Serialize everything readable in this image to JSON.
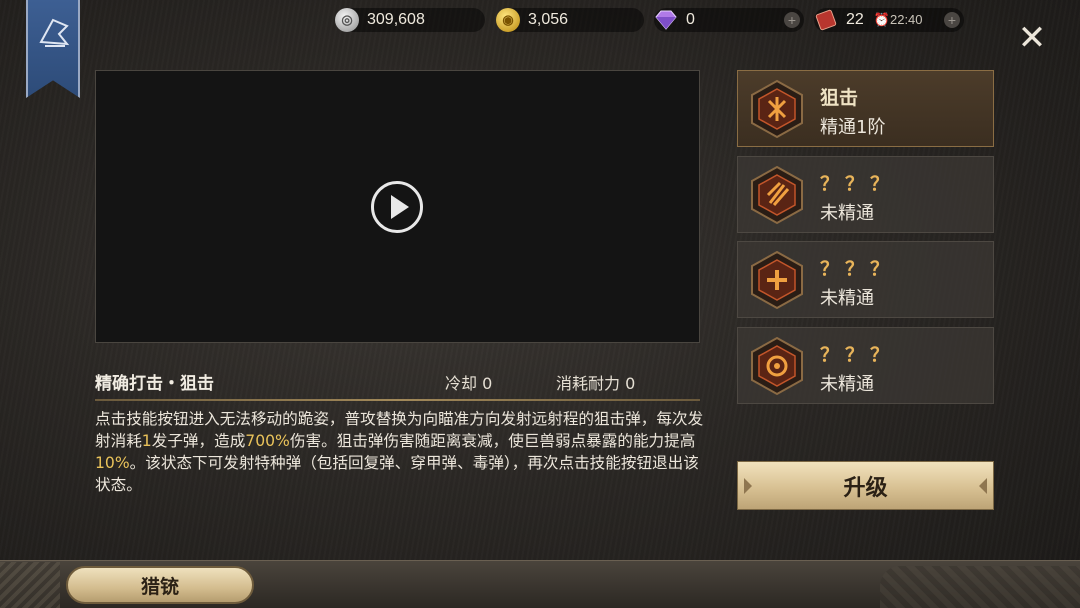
{
  "header": {
    "currencies": {
      "silver": {
        "value": "309,608",
        "icon": "silver-coin-icon"
      },
      "gold": {
        "value": "3,056",
        "icon": "gold-coin-icon"
      },
      "gem": {
        "value": "0",
        "icon": "diamond-icon"
      },
      "ticket": {
        "value": "22",
        "icon": "ticket-icon",
        "timer": "22:40"
      }
    },
    "close_label": "✕"
  },
  "skill": {
    "title": "精确打击・狙击",
    "cooldown": "冷却 0",
    "stamina_cost": "消耗耐力 0",
    "description": {
      "p1": "点击技能按钮进入无法移动的跪姿，普攻替换为向瞄准方向发射远射程的狙击弹，每次发射消耗",
      "v1": "1",
      "p2": "发子弹，造成",
      "v2": "700%",
      "p3": "伤害。狙击弹伤害随距离衰减，使巨兽弱点暴露的能力提高",
      "v3": "10%",
      "p4": "。该状态下可发射特种弹（包括回复弹、穿甲弹、毒弹），再次点击技能按钮退出该状态。"
    }
  },
  "skill_list": [
    {
      "name": "狙击",
      "status": "精通1阶",
      "icon": "sniper-skill-icon",
      "active": true
    },
    {
      "name": "？？？",
      "status": "未精通",
      "icon": "locked-skill-icon-2",
      "active": false
    },
    {
      "name": "？？？",
      "status": "未精通",
      "icon": "locked-skill-icon-3",
      "active": false
    },
    {
      "name": "？？？",
      "status": "未精通",
      "icon": "locked-skill-icon-4",
      "active": false
    }
  ],
  "upgrade_label": "升级",
  "bottom_tab_label": "猎铳",
  "colors": {
    "highlight": "#e9c25a",
    "accent_gold": "#d8c193",
    "banner_blue": "#3d5f93"
  }
}
